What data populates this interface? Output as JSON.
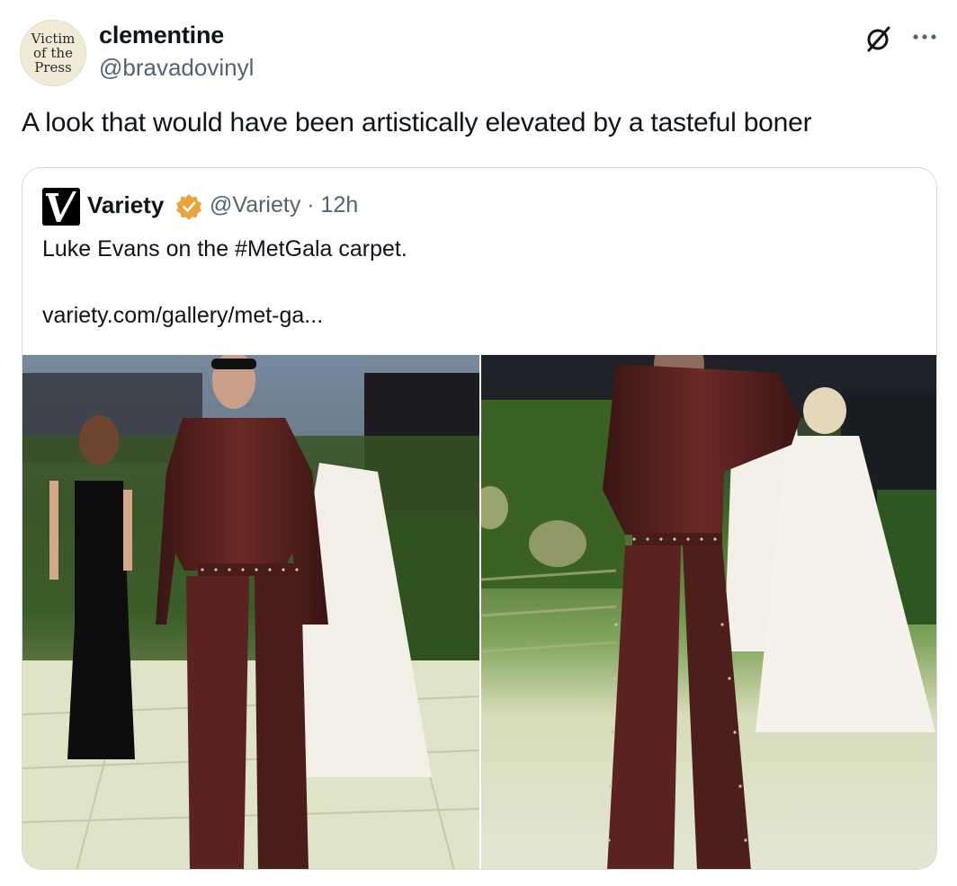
{
  "author": {
    "avatar_lines": [
      "Victim",
      "of the",
      "Press"
    ],
    "display_name": "clementine",
    "handle": "@bravadovinyl"
  },
  "actions": {
    "grok_icon": "grok-icon",
    "more_icon": "more-icon"
  },
  "tweet": {
    "text": "A look that would have been artistically elevated by a tasteful boner"
  },
  "quoted": {
    "logo_icon": "variety-logo-icon",
    "name": "Variety",
    "verified_color": "#e8a33d",
    "handle_time": "@Variety · 12h",
    "text": "Luke Evans on the #MetGala carpet.",
    "link": "variety.com/gallery/met-ga..."
  },
  "media": {
    "photos": [
      {
        "subject": "front-view-photo"
      },
      {
        "subject": "back-view-photo"
      }
    ]
  }
}
